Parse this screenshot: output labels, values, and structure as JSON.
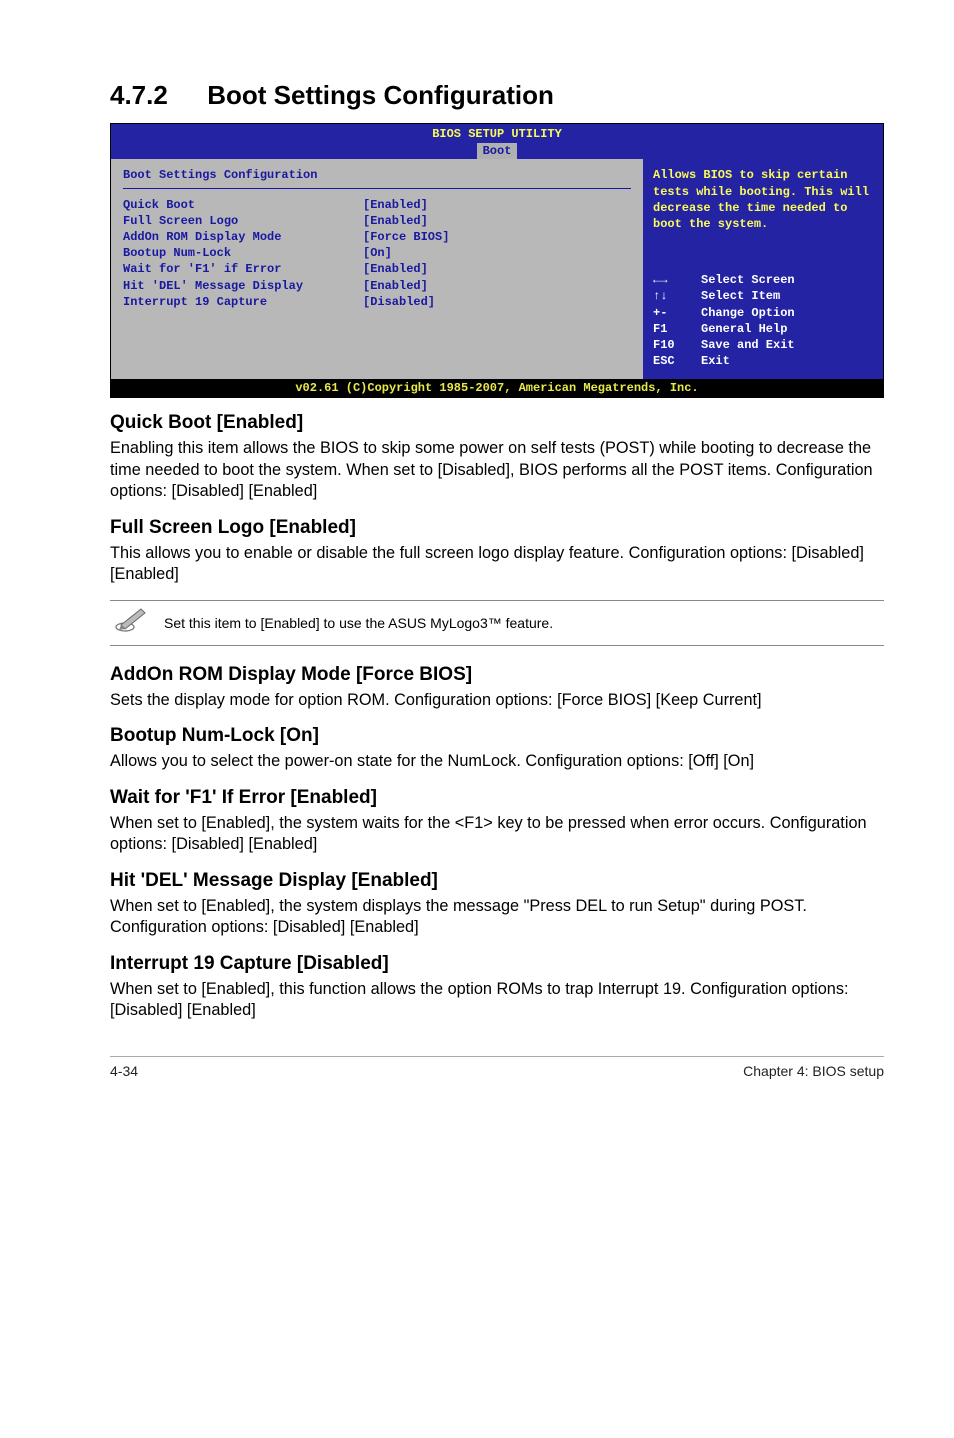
{
  "section": {
    "number": "4.7.2",
    "title": "Boot Settings Configuration"
  },
  "bios": {
    "header_title": "BIOS SETUP UTILITY",
    "tab": "Boot",
    "panel_title": "Boot Settings Configuration",
    "rows": [
      {
        "k": "Quick Boot",
        "v": "[Enabled]"
      },
      {
        "k": "Full Screen Logo",
        "v": "[Enabled]"
      },
      {
        "k": "AddOn ROM Display Mode",
        "v": "[Force BIOS]"
      },
      {
        "k": "Bootup Num-Lock",
        "v": "[On]"
      },
      {
        "k": "Wait for 'F1' if Error",
        "v": "[Enabled]"
      },
      {
        "k": "Hit 'DEL' Message Display",
        "v": "[Enabled]"
      },
      {
        "k": "Interrupt 19 Capture",
        "v": "[Disabled]"
      }
    ],
    "help_text": "Allows BIOS to skip certain tests while booting. This will decrease the time needed to boot the system.",
    "keys": [
      {
        "key": "←→",
        "desc": "Select Screen"
      },
      {
        "key": "↑↓",
        "desc": "Select Item"
      },
      {
        "key": "+-",
        "desc": "Change Option"
      },
      {
        "key": "F1",
        "desc": "General Help"
      },
      {
        "key": "F10",
        "desc": "Save and Exit"
      },
      {
        "key": "ESC",
        "desc": "Exit"
      }
    ],
    "footer": "v02.61 (C)Copyright 1985-2007, American Megatrends, Inc."
  },
  "items": {
    "quickboot": {
      "title": "Quick Boot [Enabled]",
      "body": "Enabling this item allows the BIOS to skip some power on self tests (POST) while booting to decrease the time needed to boot the system. When set to [Disabled], BIOS performs all the POST items. Configuration options: [Disabled] [Enabled]"
    },
    "fullscreen": {
      "title": "Full Screen Logo [Enabled]",
      "body": "This allows you to enable or disable the full screen logo display feature. Configuration options: [Disabled] [Enabled]"
    },
    "note": "Set this item to [Enabled] to use the ASUS MyLogo3™ feature.",
    "addon": {
      "title": "AddOn ROM Display Mode [Force BIOS]",
      "body": "Sets the display mode for option ROM. Configuration options: [Force BIOS] [Keep Current]"
    },
    "numlock": {
      "title": "Bootup Num-Lock [On]",
      "body": "Allows you to select the power-on state for the NumLock. Configuration options: [Off] [On]"
    },
    "waitf1": {
      "title": "Wait for 'F1' If Error [Enabled]",
      "body": "When set to [Enabled], the system waits for the <F1> key to be pressed when error occurs. Configuration options: [Disabled] [Enabled]"
    },
    "hitdel": {
      "title": "Hit 'DEL' Message Display [Enabled]",
      "body": "When set to [Enabled], the system displays the message \"Press DEL to run Setup\" during POST. Configuration options: [Disabled] [Enabled]"
    },
    "int19": {
      "title": "Interrupt 19 Capture [Disabled]",
      "body": "When set to [Enabled], this function allows the option ROMs to trap Interrupt 19. Configuration options: [Disabled] [Enabled]"
    }
  },
  "footer": {
    "left": "4-34",
    "right": "Chapter 4: BIOS setup"
  }
}
